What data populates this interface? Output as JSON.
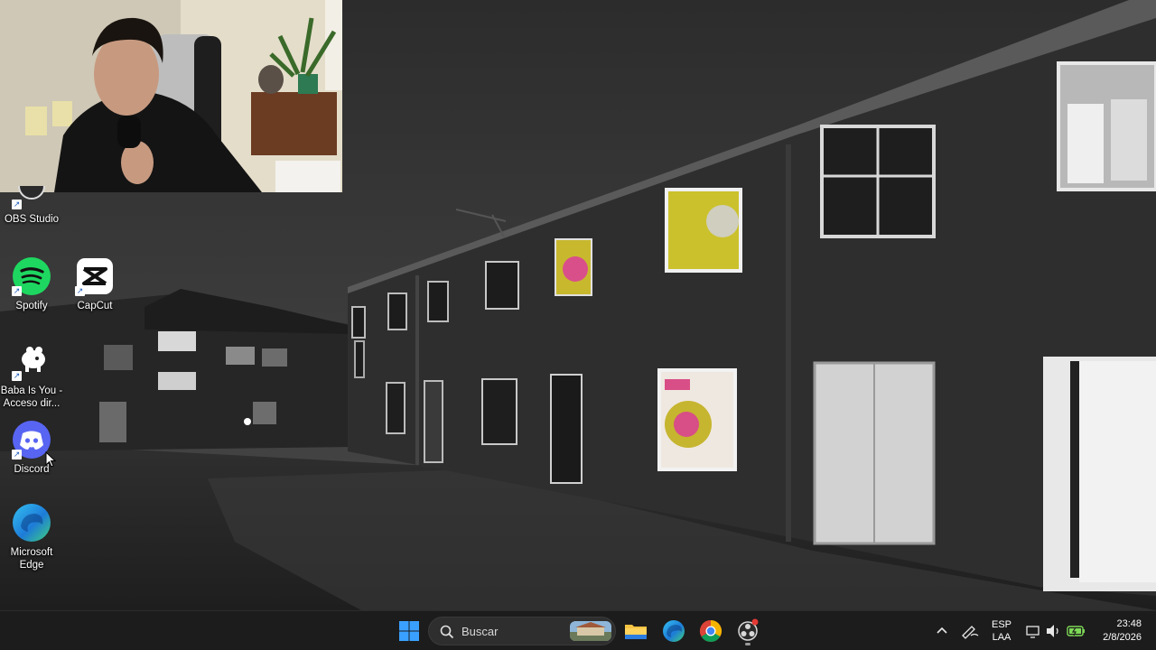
{
  "desktop": {
    "icons": [
      {
        "id": "obs",
        "label": "OBS Studio"
      },
      {
        "id": "spotify",
        "label": "Spotify"
      },
      {
        "id": "capcut",
        "label": "CapCut"
      },
      {
        "id": "baba",
        "label": "Baba Is You - Acceso dir..."
      },
      {
        "id": "discord",
        "label": "Discord"
      },
      {
        "id": "edge",
        "label": "Microsoft Edge"
      }
    ]
  },
  "taskbar": {
    "search_placeholder": "Buscar",
    "language": {
      "line1": "ESP",
      "line2": "LAA"
    },
    "clock": {
      "time": "23:48",
      "date": "2/8/2026"
    }
  },
  "colors": {
    "taskbar_bg": "#1c1c1c",
    "windows_blue": "#3aa0ff",
    "spotify_green": "#1ed760",
    "discord_blurple": "#5865f2"
  }
}
